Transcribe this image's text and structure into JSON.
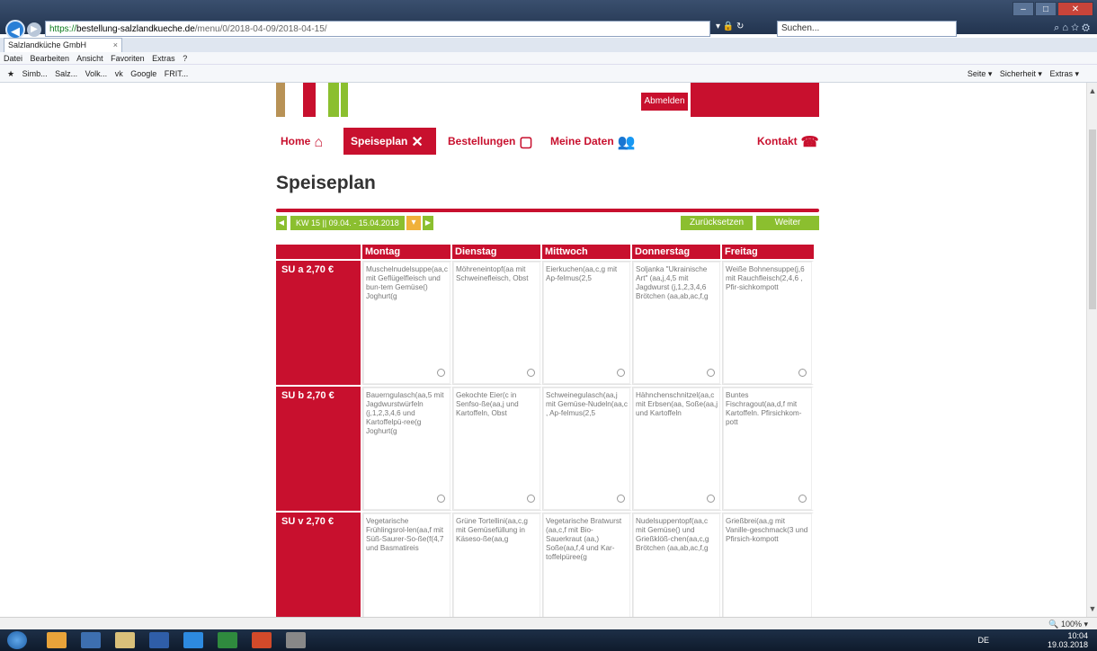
{
  "browser": {
    "url_https": "https://",
    "url_domain": "bestellung-salzlandkueche.de",
    "url_path": "/menu/0/2018-04-09/2018-04-15/",
    "search_placeholder": "Suchen...",
    "tab_title": "Salzlandküche GmbH",
    "menu": [
      "Datei",
      "Bearbeiten",
      "Ansicht",
      "Favoriten",
      "Extras",
      "?"
    ],
    "favorites": [
      "Simb...",
      "Salz...",
      "Volk...",
      "vk",
      "Google",
      "FRIT..."
    ],
    "toolbar_right": [
      "Seite ▾",
      "Sicherheit ▾",
      "Extras ▾"
    ],
    "zoom": "100%"
  },
  "header": {
    "logout_label": "Abmelden"
  },
  "nav": {
    "home": "Home",
    "menu_plan": "Speiseplan",
    "orders": "Bestellungen",
    "my_data": "Meine Daten",
    "contact": "Kontakt"
  },
  "page_title": "Speiseplan",
  "week": {
    "label": "KW 15 || 09.04. - 15.04.2018",
    "reset_label": "Zurücksetzen",
    "next_label": "Weiter"
  },
  "table": {
    "days": [
      "Montag",
      "Dienstag",
      "Mittwoch",
      "Donnerstag",
      "Freitag"
    ],
    "rows": [
      {
        "label": "SU a 2,70 €",
        "cells": [
          "Muschelnudelsuppe(aa,c mit Geflügelfleisch und bun-tem Gemüse() Joghurt(g",
          "Möhreneintopf(aa mit Schweinefleisch, Obst",
          "Eierkuchen(aa,c,g mit Ap-felmus(2,5",
          "Soljanka \"Ukrainische Art\" (aa,j,4,5 mit Jagdwurst (j,1,2,3,4,6 Brötchen (aa,ab,ac,f,g",
          "Weiße Bohnensuppe(j,6 mit Rauchfleisch(2,4,6 , Pfir-sichkompott"
        ]
      },
      {
        "label": "SU b 2,70 €",
        "cells": [
          "Bauerngulasch(aa,5 mit Jagdwurstwürfeln (j,1,2,3,4,6 und Kartoffelpü-ree(g Joghurt(g",
          "Gekochte Eier(c in Senfso-ße(aa,j und Kartoffeln, Obst",
          "Schweinegulasch(aa,j mit Gemüse-Nudeln(aa,c , Ap-felmus(2,5",
          "Hähnchenschnitzel(aa,c mit Erbsen(aa, Soße(aa,j und Kartoffeln",
          "Buntes Fischragout(aa,d,f mit Kartoffeln. Pfirsichkom-pott"
        ]
      },
      {
        "label": "SU v 2,70 €",
        "cells": [
          "Vegetarische Frühlingsrol-len(aa,f mit Süß-Saurer-So-ße(f(4,7 und Basmatireis",
          "Grüne Tortellini(aa,c,g mit Gemüsefüllung in Käseso-ße(aa,g",
          "Vegetarische Bratwurst (aa,c,f mit Bio-Sauerkraut (aa,) Soße(aa,f,4 und Kar-toffelpüree(g",
          "Nudelsuppentopf(aa,c mit Gemüse() und Grießklöß-chen(aa,c,g Brötchen (aa,ab,ac,f,g",
          "Grießbrei(aa,g mit Vanille-geschmack(3 und Pfirsich-kompott"
        ]
      }
    ]
  },
  "tray": {
    "lang": "DE",
    "time": "10:04",
    "date": "19.03.2018"
  },
  "colors": {
    "brand_red": "#c8102e",
    "brand_green": "#8bbf2f",
    "calendar_orange": "#f0b13a"
  }
}
